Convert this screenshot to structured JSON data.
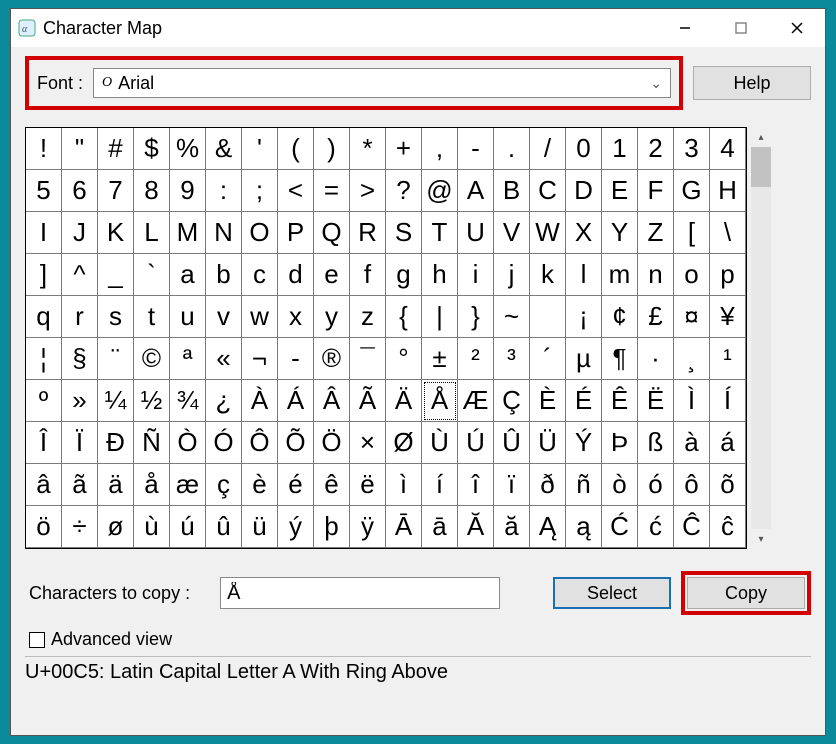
{
  "window": {
    "title": "Character Map"
  },
  "font_row": {
    "label": "Font :",
    "selected": "Arial",
    "help_label": "Help"
  },
  "chars": [
    "!",
    "\"",
    "#",
    "$",
    "%",
    "&",
    "'",
    "(",
    ")",
    "*",
    "+",
    ",",
    "-",
    ".",
    "/",
    "0",
    "1",
    "2",
    "3",
    "4",
    "5",
    "6",
    "7",
    "8",
    "9",
    ":",
    ";",
    "<",
    "=",
    ">",
    "?",
    "@",
    "A",
    "B",
    "C",
    "D",
    "E",
    "F",
    "G",
    "H",
    "I",
    "J",
    "K",
    "L",
    "M",
    "N",
    "O",
    "P",
    "Q",
    "R",
    "S",
    "T",
    "U",
    "V",
    "W",
    "X",
    "Y",
    "Z",
    "[",
    "\\",
    "]",
    "^",
    "_",
    "`",
    "a",
    "b",
    "c",
    "d",
    "e",
    "f",
    "g",
    "h",
    "i",
    "j",
    "k",
    "l",
    "m",
    "n",
    "o",
    "p",
    "q",
    "r",
    "s",
    "t",
    "u",
    "v",
    "w",
    "x",
    "y",
    "z",
    "{",
    "|",
    "}",
    "~",
    "",
    "¡",
    "¢",
    "£",
    "¤",
    "¥",
    "¦",
    "§",
    "¨",
    "©",
    "ª",
    "«",
    "¬",
    "-",
    "®",
    "¯",
    "°",
    "±",
    "²",
    "³",
    "´",
    "µ",
    "¶",
    "·",
    "¸",
    "¹",
    "º",
    "»",
    "¼",
    "½",
    "¾",
    "¿",
    "À",
    "Á",
    "Â",
    "Ã",
    "Ä",
    "Å",
    "Æ",
    "Ç",
    "È",
    "É",
    "Ê",
    "Ë",
    "Ì",
    "Í",
    "Î",
    "Ï",
    "Ð",
    "Ñ",
    "Ò",
    "Ó",
    "Ô",
    "Õ",
    "Ö",
    "×",
    "Ø",
    "Ù",
    "Ú",
    "Û",
    "Ü",
    "Ý",
    "Þ",
    "ß",
    "à",
    "á",
    "â",
    "ã",
    "ä",
    "å",
    "æ",
    "ç",
    "è",
    "é",
    "ê",
    "ë",
    "ì",
    "í",
    "î",
    "ï",
    "ð",
    "ñ",
    "ò",
    "ó",
    "ô",
    "õ",
    "ö",
    "÷",
    "ø",
    "ù",
    "ú",
    "û",
    "ü",
    "ý",
    "þ",
    "ÿ",
    "Ā",
    "ā",
    "Ă",
    "ă",
    "Ą",
    "ą",
    "Ć",
    "ć",
    "Ĉ",
    "ĉ"
  ],
  "selected_index": 131,
  "copy_row": {
    "label": "Characters to copy :",
    "value": "Å",
    "select_label": "Select",
    "copy_label": "Copy"
  },
  "advanced": {
    "label": "Advanced view",
    "checked": false
  },
  "status": "U+00C5: Latin Capital Letter A With Ring Above"
}
